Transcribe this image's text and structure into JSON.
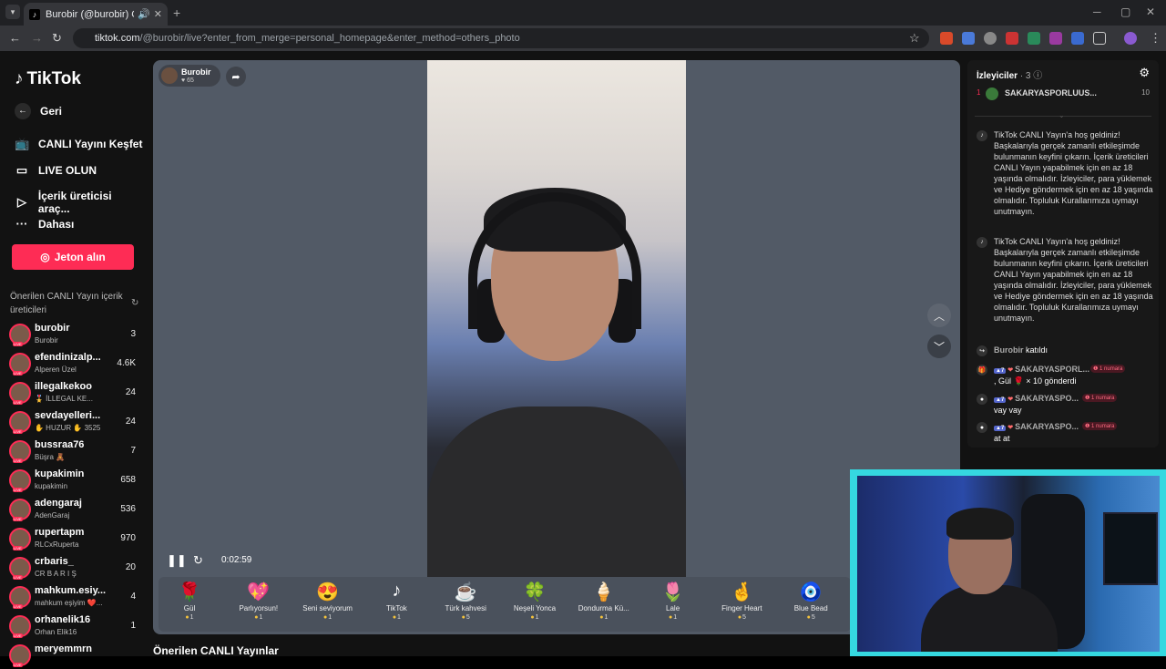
{
  "browser": {
    "tab_title": "Burobir (@burobir) CANLI Y",
    "url_host": "tiktok.com",
    "url_path": "/@burobir/live?enter_from_merge=personal_homepage&enter_method=others_photo"
  },
  "sidebar": {
    "logo": "TikTok",
    "back": "Geri",
    "items": [
      {
        "label": "CANLI Yayını Keşfet",
        "icon": "tv-icon"
      },
      {
        "label": "LIVE OLUN",
        "icon": "camera-icon"
      },
      {
        "label": "İçerik üreticisi araç...",
        "icon": "play-circle-icon"
      },
      {
        "label": "Dahası",
        "icon": "more-icon"
      }
    ],
    "coin_button": "Jeton alın",
    "recommended_title": "Önerilen CANLI Yayın içerik üreticileri",
    "creators": [
      {
        "name": "burobir",
        "sub": "Burobir",
        "count": "3"
      },
      {
        "name": "efendinizalp...",
        "sub": "Alperen Üzel",
        "count": "4.6K"
      },
      {
        "name": "illegalkekoo",
        "sub": "🎖️ İLLEGAL KE...",
        "count": "24"
      },
      {
        "name": "sevdayelleri...",
        "sub": "✋ HUZUR ✋ 3525",
        "count": "24"
      },
      {
        "name": "bussraa76",
        "sub": "Büşra 🧸",
        "count": "7"
      },
      {
        "name": "kupakimin",
        "sub": "kupakimin",
        "count": "658"
      },
      {
        "name": "adengaraj",
        "sub": "AdenGaraj",
        "count": "536"
      },
      {
        "name": "rupertapm",
        "sub": "RLCxRuperta",
        "count": "970"
      },
      {
        "name": "crbaris_",
        "sub": "CR B A R I Ş",
        "count": "20"
      },
      {
        "name": "mahkum.esiy...",
        "sub": "mahkum eşiyim ❤️...",
        "count": "4"
      },
      {
        "name": "orhanelik16",
        "sub": "Orhan Elik16",
        "count": "1"
      },
      {
        "name": "meryemmrn",
        "sub": "",
        "count": ""
      }
    ]
  },
  "player": {
    "host_name": "Burobir",
    "host_likes": "65",
    "elapsed": "0:02:59"
  },
  "gifts": [
    {
      "name": "Gül",
      "price": "1",
      "glyph": "🌹"
    },
    {
      "name": "Parlıyorsun!",
      "price": "1",
      "glyph": "💖"
    },
    {
      "name": "Seni seviyorum",
      "price": "1",
      "glyph": "😍"
    },
    {
      "name": "TikTok",
      "price": "1",
      "glyph": "♪"
    },
    {
      "name": "Türk kahvesi",
      "price": "5",
      "glyph": "☕"
    },
    {
      "name": "Neşeli Yonca",
      "price": "1",
      "glyph": "🍀"
    },
    {
      "name": "Dondurma Kü...",
      "price": "1",
      "glyph": "🍦"
    },
    {
      "name": "Lale",
      "price": "1",
      "glyph": "🌷"
    },
    {
      "name": "Finger Heart",
      "price": "5",
      "glyph": "🤞"
    },
    {
      "name": "Blue Bead",
      "price": "5",
      "glyph": "🧿"
    }
  ],
  "recommended_live": "Önerilen CANLI Yayınlar",
  "chat": {
    "viewers_label": "İzleyiciler",
    "viewers_count": "· 3",
    "top_viewer": {
      "rank": "1",
      "name": "SAKARYASPORLUUS...",
      "count": "10"
    },
    "system_messages": [
      "TikTok CANLI Yayın'a hoş geldiniz! Başkalarıyla gerçek zamanlı etkileşimde bulunmanın keyfini çıkarın. İçerik üreticileri CANLI Yayın yapabilmek için en az 18 yaşında olmalıdır. İzleyiciler, para yüklemek ve Hediye göndermek için en az 18 yaşında olmalıdır. Topluluk Kurallarımıza uymayı unutmayın.",
      "TikTok CANLI Yayın'a hoş geldiniz! Başkalarıyla gerçek zamanlı etkileşimde bulunmanın keyfini çıkarın. İçerik üreticileri CANLI Yayın yapabilmek için en az 18 yaşında olmalıdır. İzleyiciler, para yüklemek ve Hediye göndermek için en az 18 yaşında olmalıdır. Topluluk Kurallarımıza uymayı unutmayın."
    ],
    "join": {
      "user": "Burobir",
      "text": "katıldı"
    },
    "messages": [
      {
        "level": "7",
        "user": "SAKARYASPORL...",
        "badge": "1 numara",
        "body": ", Gül 🌹 × 10 gönderdi"
      },
      {
        "level": "7",
        "user": "SAKARYASPO...",
        "badge": "1 numara",
        "body": "vay vay"
      },
      {
        "level": "7",
        "user": "SAKARYASPO...",
        "badge": "1 numara",
        "body": "at at"
      }
    ]
  }
}
